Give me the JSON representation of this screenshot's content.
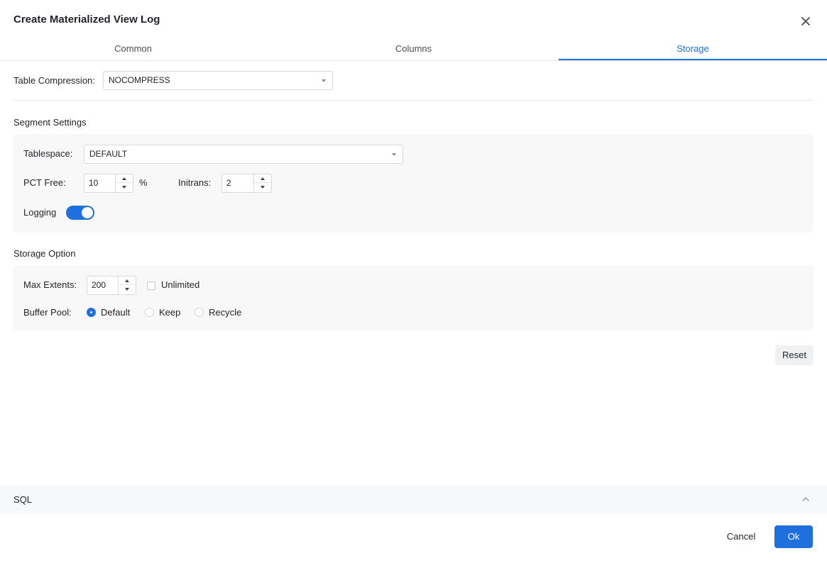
{
  "dialog": {
    "title": "Create Materialized View Log"
  },
  "tabs": [
    {
      "label": "Common",
      "active": false
    },
    {
      "label": "Columns",
      "active": false
    },
    {
      "label": "Storage",
      "active": true
    }
  ],
  "storage": {
    "table_compression_label": "Table Compression:",
    "table_compression_value": "NOCOMPRESS",
    "segment_settings": {
      "title": "Segment Settings",
      "tablespace_label": "Tablespace:",
      "tablespace_value": "DEFAULT",
      "pct_free_label": "PCT Free:",
      "pct_free_value": "10",
      "pct_unit": "%",
      "initrans_label": "Initrans:",
      "initrans_value": "2",
      "logging_label": "Logging",
      "logging_on": true
    },
    "storage_option": {
      "title": "Storage Option",
      "max_extents_label": "Max Extents:",
      "max_extents_value": "200",
      "unlimited_label": "Unlimited",
      "unlimited_checked": false,
      "buffer_pool_label": "Buffer Pool:",
      "buffer_pool_options": [
        "Default",
        "Keep",
        "Recycle"
      ],
      "buffer_pool_selected": "Default"
    },
    "reset_label": "Reset"
  },
  "sql_panel": {
    "label": "SQL",
    "collapsed": false
  },
  "footer": {
    "cancel_label": "Cancel",
    "ok_label": "Ok"
  },
  "colors": {
    "accent": "#1f6fde",
    "panel_bg": "#f8f8f9"
  },
  "icons": {
    "close": "close-icon",
    "dropdown": "caret-down-icon",
    "step_up": "caret-up-icon",
    "step_down": "caret-down-icon",
    "collapse": "chevron-up-icon"
  }
}
